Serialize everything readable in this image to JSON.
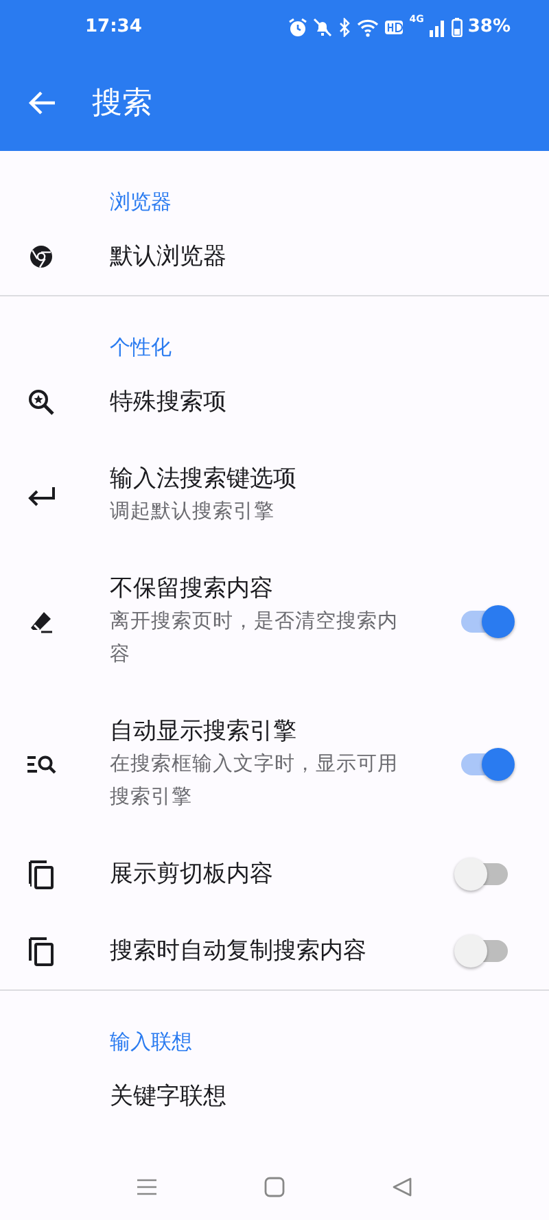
{
  "status_bar": {
    "time": "17:34",
    "network": "4G",
    "battery": "38%"
  },
  "app_bar": {
    "title": "搜索"
  },
  "sections": [
    {
      "header": "浏览器",
      "items": [
        {
          "kind": "plain",
          "title": "默认浏览器"
        }
      ]
    },
    {
      "header": "个性化",
      "items": [
        {
          "kind": "plain",
          "title": "特殊搜索项"
        },
        {
          "kind": "plain",
          "title": "输入法搜索键选项",
          "subtitle": "调起默认搜索引擎"
        },
        {
          "kind": "toggle",
          "title": "不保留搜索内容",
          "subtitle": "离开搜索页时，是否清空搜索内容",
          "on": true
        },
        {
          "kind": "toggle",
          "title": "自动显示搜索引擎",
          "subtitle": "在搜索框输入文字时，显示可用搜索引擎",
          "on": true
        },
        {
          "kind": "toggle",
          "title": "展示剪切板内容",
          "on": false
        },
        {
          "kind": "toggle",
          "title": "搜索时自动复制搜索内容",
          "on": false
        }
      ]
    },
    {
      "header": "输入联想",
      "items": [
        {
          "kind": "plain",
          "title": "关键字联想"
        }
      ]
    }
  ]
}
